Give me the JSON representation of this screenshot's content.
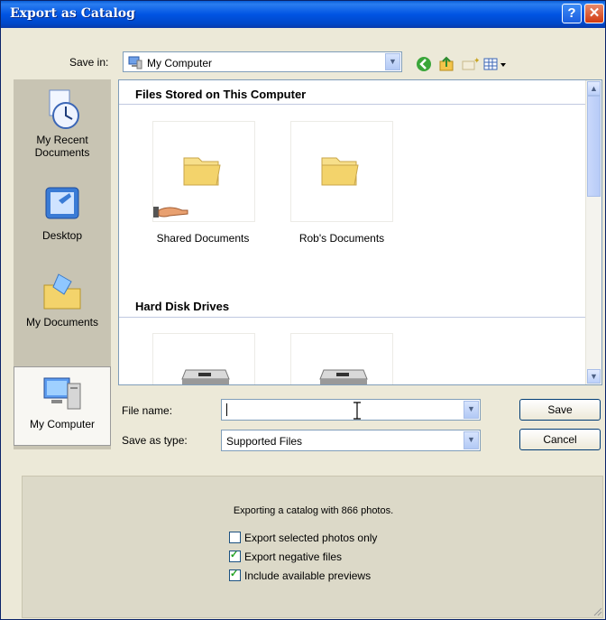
{
  "window": {
    "title": "Export as Catalog"
  },
  "toolbar": {
    "save_in_label": "Save in:",
    "save_in_value": "My Computer"
  },
  "places": [
    {
      "label": "My Recent Documents",
      "icon": "recent-documents-icon"
    },
    {
      "label": "Desktop",
      "icon": "desktop-icon"
    },
    {
      "label": "My Documents",
      "icon": "my-documents-icon"
    },
    {
      "label": "My Computer",
      "icon": "my-computer-icon"
    }
  ],
  "file_pane": {
    "groups": [
      {
        "header": "Files Stored on This Computer",
        "items": [
          {
            "label": "Shared Documents"
          },
          {
            "label": "Rob's Documents"
          }
        ]
      },
      {
        "header": "Hard Disk Drives",
        "items": [
          {
            "label": ""
          },
          {
            "label": ""
          }
        ]
      }
    ]
  },
  "form": {
    "file_name_label": "File name:",
    "file_name_value": "",
    "save_type_label": "Save as type:",
    "save_type_value": "Supported Files",
    "save_button": "Save",
    "cancel_button": "Cancel"
  },
  "export": {
    "message": "Exporting a catalog with 866 photos.",
    "options": [
      {
        "label": "Export selected photos only",
        "checked": false
      },
      {
        "label": "Export negative files",
        "checked": true
      },
      {
        "label": "Include available previews",
        "checked": true
      }
    ]
  }
}
